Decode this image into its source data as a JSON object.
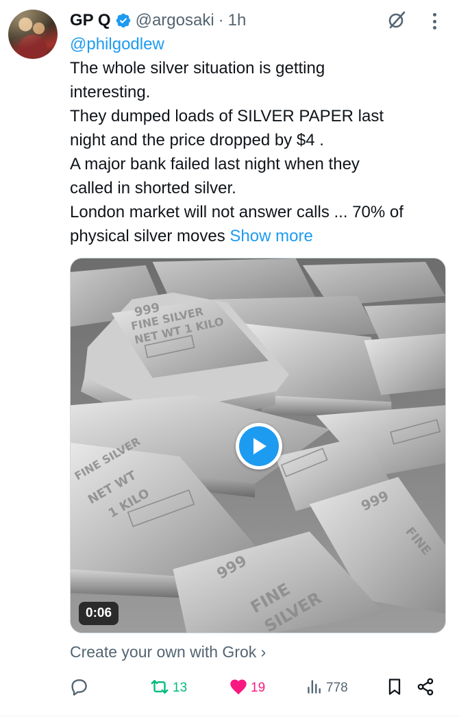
{
  "tweet": {
    "author": {
      "display_name": "GP Q",
      "handle": "@argosaki",
      "separator": "·",
      "time": "1h",
      "verified": true
    },
    "reply_to": "@philgodlew",
    "text_lines": [
      "The whole silver situation is getting",
      "interesting.",
      "They dumped loads of SILVER PAPER last",
      "night and the price dropped by $4 .",
      "A major bank failed last night when they",
      "called in shorted silver.",
      "London market will not answer calls ... 70% of",
      "physical silver moves"
    ],
    "show_more": "Show more",
    "media": {
      "type": "video",
      "duration": "0:06"
    },
    "grok_link": "Create your own with Grok",
    "grok_chevron": "›",
    "actions": {
      "replies": "",
      "reposts": "13",
      "likes": "19",
      "views": "778"
    }
  },
  "icons": {
    "verified": "verified-badge-icon",
    "grok": "grok-icon",
    "more": "more-icon",
    "play": "play-icon",
    "reply": "reply-icon",
    "repost": "repost-icon",
    "like": "heart-icon",
    "views": "views-icon",
    "bookmark": "bookmark-icon",
    "share": "share-icon"
  },
  "colors": {
    "accent": "#1d9bf0",
    "repost": "#00ba7c",
    "like": "#f91880",
    "muted": "#536471",
    "text": "#0f1419"
  }
}
